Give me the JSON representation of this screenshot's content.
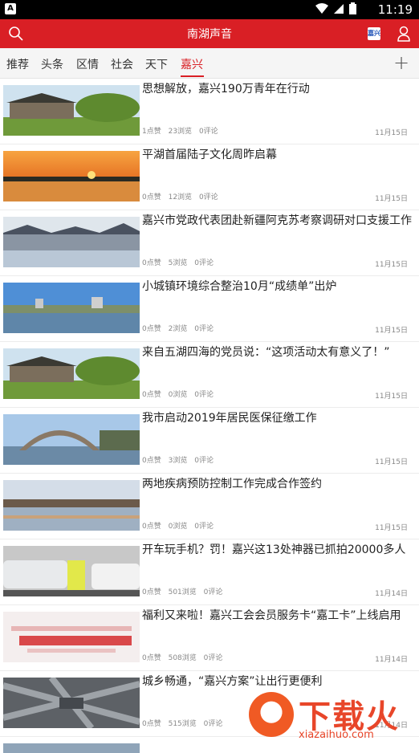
{
  "status_bar": {
    "notification_icon": "A",
    "time": "11:19"
  },
  "header": {
    "title": "南湖声音",
    "badge_text": "嘉兴"
  },
  "tabs": [
    {
      "label": "推荐"
    },
    {
      "label": "头条"
    },
    {
      "label": "区情"
    },
    {
      "label": "社会"
    },
    {
      "label": "天下"
    },
    {
      "label": "嘉兴"
    }
  ],
  "active_tab": "嘉兴",
  "articles": [
    {
      "title": "思想解放，嘉兴190万青年在行动",
      "likes": "1点赞",
      "views": "23浏览",
      "comments": "0评论",
      "date": "11月15日"
    },
    {
      "title": "平湖首届陆子文化周昨启幕",
      "likes": "0点赞",
      "views": "12浏览",
      "comments": "0评论",
      "date": "11月15日"
    },
    {
      "title": "嘉兴市党政代表团赴新疆阿克苏考察调研对口支援工作",
      "likes": "0点赞",
      "views": "5浏览",
      "comments": "0评论",
      "date": "11月15日"
    },
    {
      "title": "小城镇环境综合整治10月“成绩单”出炉",
      "likes": "0点赞",
      "views": "2浏览",
      "comments": "0评论",
      "date": "11月15日"
    },
    {
      "title": "来自五湖四海的党员说：“这项活动太有意义了！”",
      "likes": "0点赞",
      "views": "0浏览",
      "comments": "0评论",
      "date": "11月15日"
    },
    {
      "title": "我市启动2019年居民医保征缴工作",
      "likes": "0点赞",
      "views": "3浏览",
      "comments": "0评论",
      "date": "11月15日"
    },
    {
      "title": "两地疾病预防控制工作完成合作签约",
      "likes": "0点赞",
      "views": "0浏览",
      "comments": "0评论",
      "date": "11月15日"
    },
    {
      "title": "开车玩手机？罚！嘉兴这13处神器已抓拍20000多人",
      "likes": "0点赞",
      "views": "501浏览",
      "comments": "0评论",
      "date": "11月14日"
    },
    {
      "title": "福利又来啦！嘉兴工会会员服务卡“嘉工卡”上线启用",
      "likes": "0点赞",
      "views": "508浏览",
      "comments": "0评论",
      "date": "11月14日"
    },
    {
      "title": "城乡畅通，“嘉兴方案”让出行更便利",
      "likes": "0点赞",
      "views": "515浏览",
      "comments": "0评论",
      "date": "11月14日"
    }
  ],
  "watermark": {
    "text": "下载火",
    "url": "xiazaihuo.com"
  }
}
